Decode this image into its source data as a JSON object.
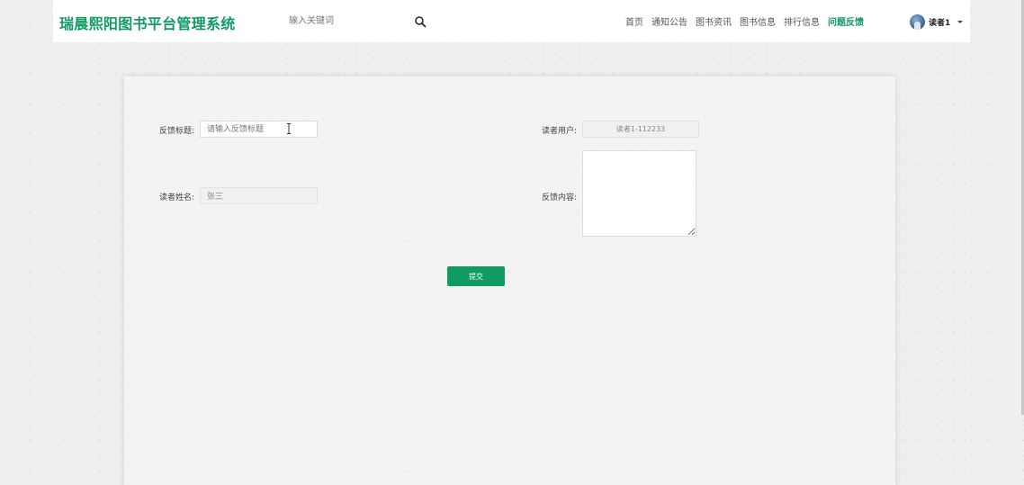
{
  "header": {
    "title": "瑞晨熙阳图书平台管理系统",
    "search": {
      "placeholder": "输入关键词",
      "value": ""
    },
    "nav": [
      {
        "label": "首页",
        "active": false
      },
      {
        "label": "通知公告",
        "active": false
      },
      {
        "label": "图书资讯",
        "active": false
      },
      {
        "label": "图书信息",
        "active": false
      },
      {
        "label": "排行信息",
        "active": false
      },
      {
        "label": "问题反馈",
        "active": true
      }
    ],
    "user": {
      "name": "读者1"
    }
  },
  "form": {
    "feedback_title": {
      "label": "反馈标题:",
      "placeholder": "请输入反馈标题",
      "value": ""
    },
    "reader_user": {
      "label": "读者用户:",
      "value": "读者1-112233"
    },
    "reader_name": {
      "label": "读者姓名:",
      "value": "张三"
    },
    "feedback_content": {
      "label": "反馈内容:",
      "value": ""
    },
    "submit_label": "提交"
  },
  "colors": {
    "accent": "#109b63",
    "page_background": "#efefef"
  }
}
